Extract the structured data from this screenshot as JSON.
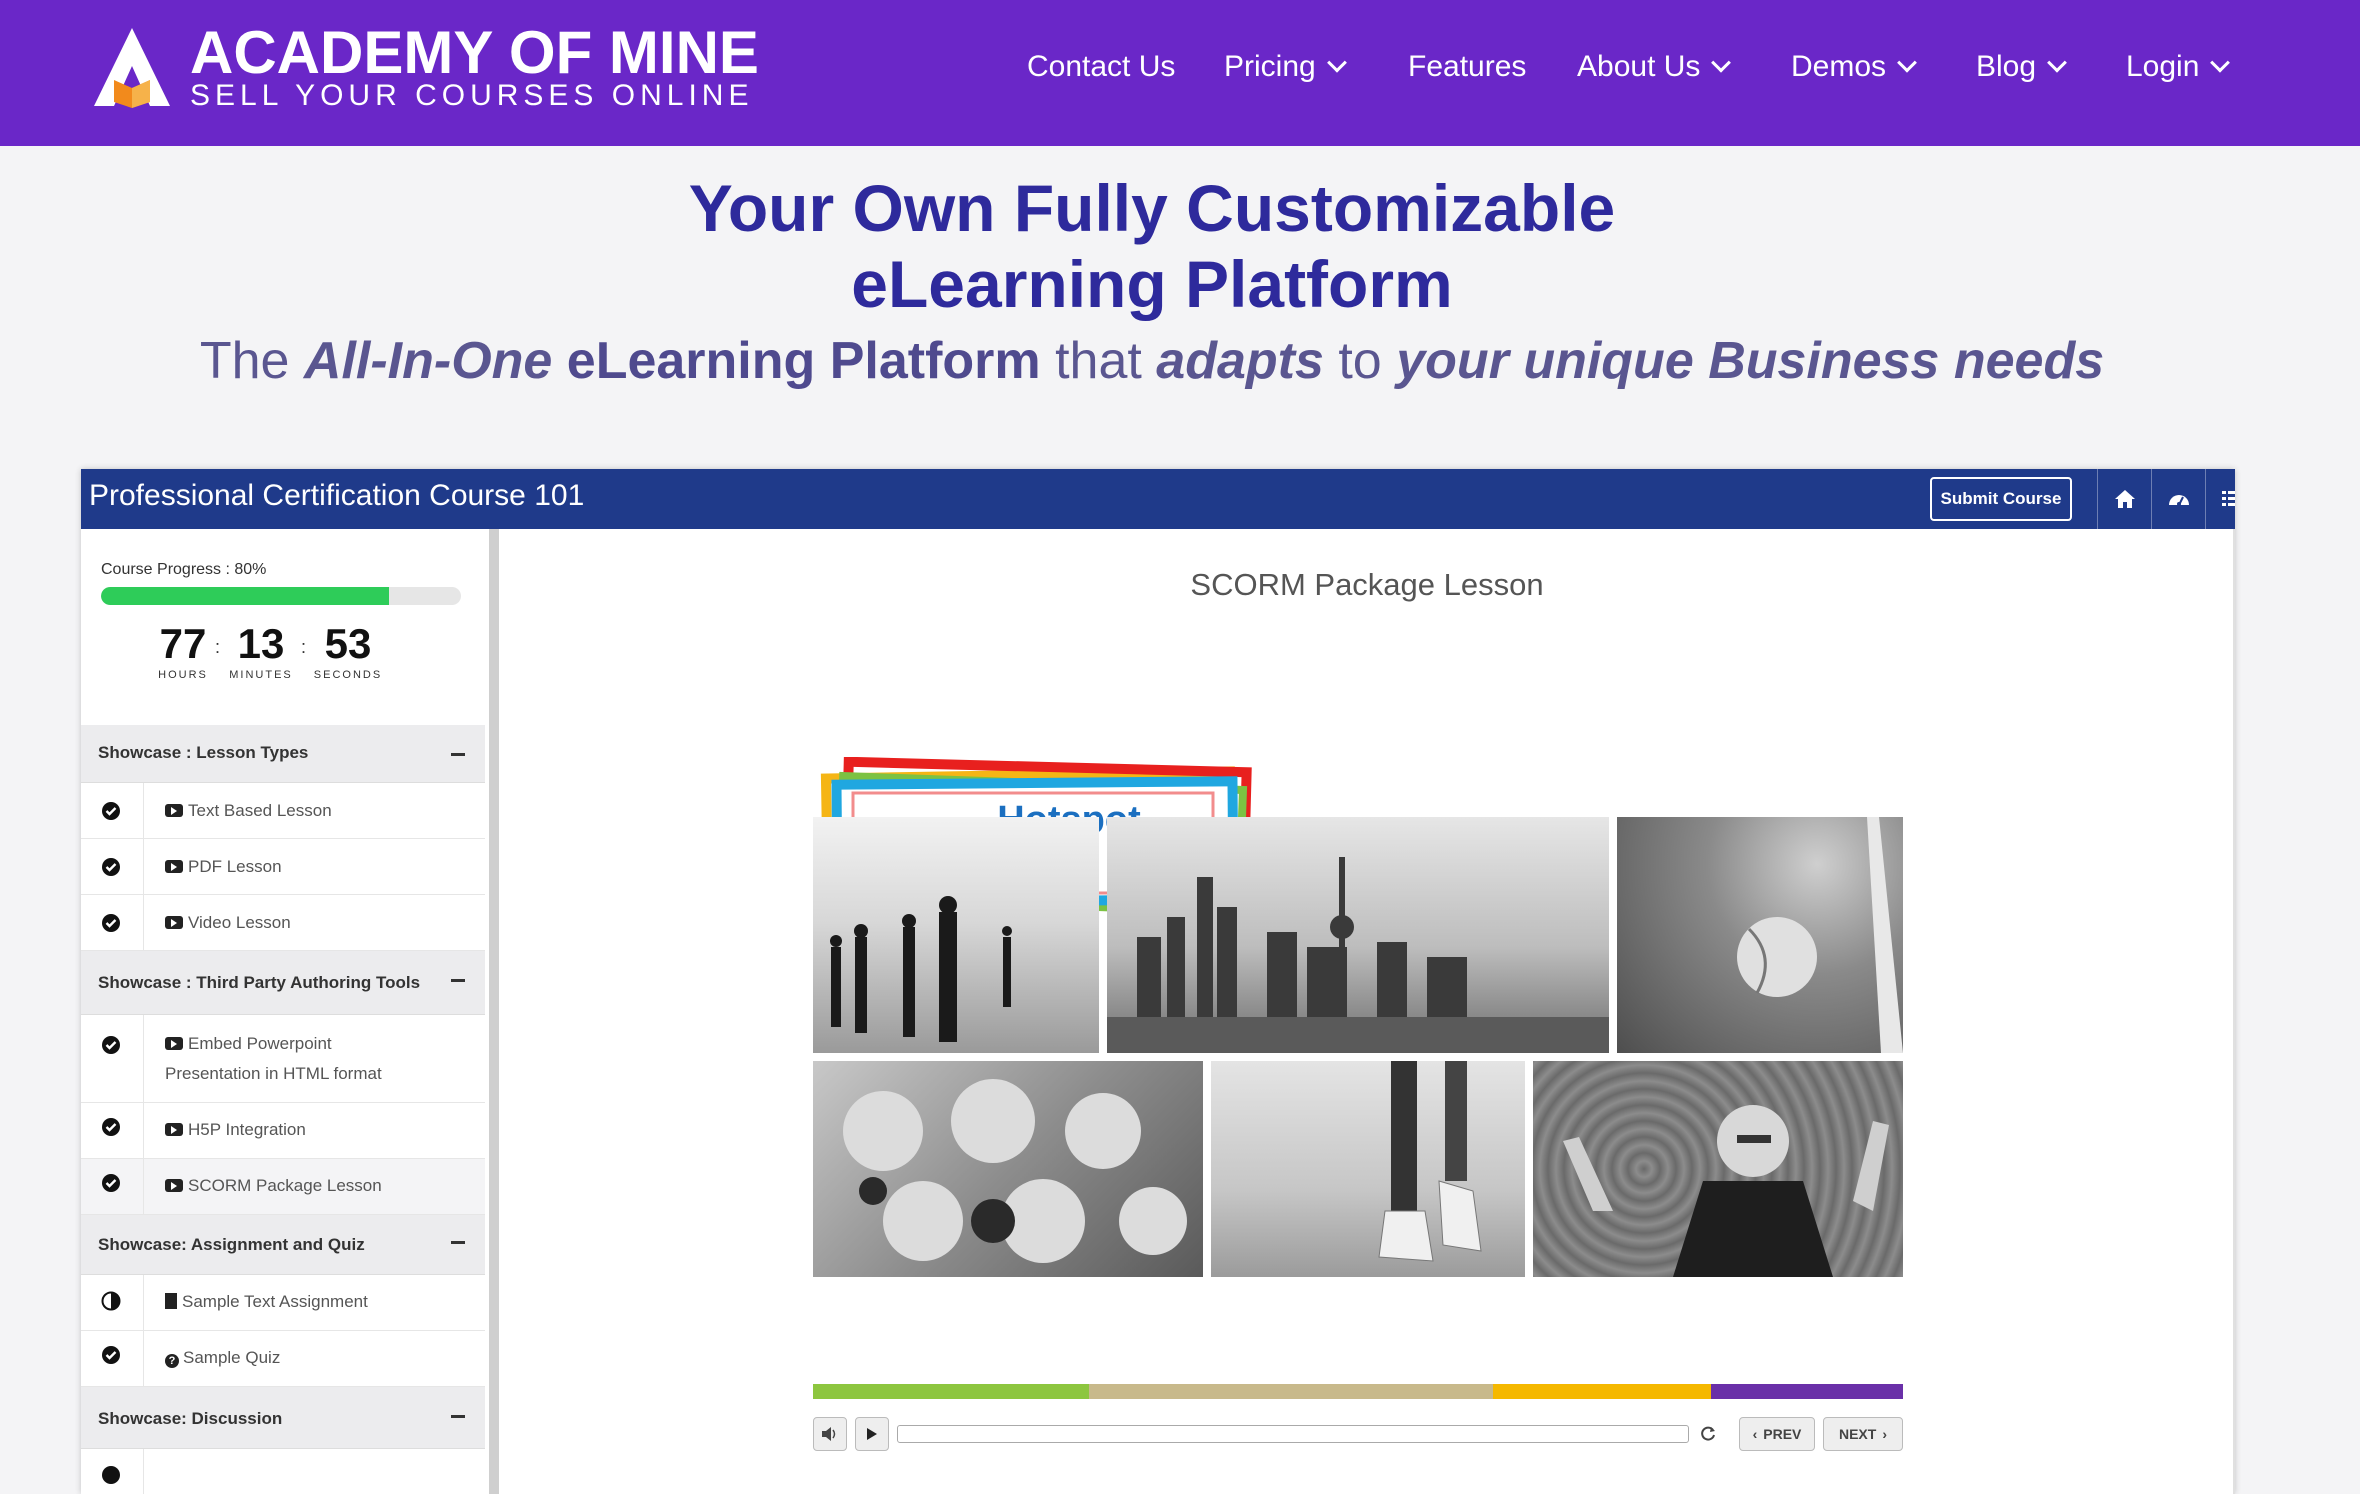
{
  "header": {
    "logo_title": "ACADEMY OF MINE",
    "logo_subtitle": "SELL YOUR COURSES ONLINE",
    "nav": [
      {
        "label": "Contact Us",
        "dropdown": false
      },
      {
        "label": "Pricing",
        "dropdown": true
      },
      {
        "label": "Features",
        "dropdown": false
      },
      {
        "label": "About Us",
        "dropdown": true
      },
      {
        "label": "Demos",
        "dropdown": true
      },
      {
        "label": "Blog",
        "dropdown": true
      },
      {
        "label": "Login",
        "dropdown": true
      }
    ]
  },
  "hero": {
    "title_line1": "Your Own Fully Customizable",
    "title_line2": "eLearning Platform",
    "sub_the": "The",
    "sub_all_in_one": "All-In-One",
    "sub_platform": "eLearning Platform",
    "sub_that": "that",
    "sub_adapts": "adapts",
    "sub_to": "to",
    "sub_needs": "your unique Business needs"
  },
  "course": {
    "title": "Professional Certification Course 101",
    "submit_label": "Submit Course",
    "progress_label": "Course Progress : 80%",
    "progress_fraction": 0.8,
    "timer": {
      "hours": "77",
      "minutes": "13",
      "seconds": "53",
      "hours_label": "HOURS",
      "minutes_label": "MINUTES",
      "seconds_label": "SECONDS"
    },
    "sections": [
      {
        "title": "Showcase : Lesson Types"
      },
      {
        "title": "Showcase : Third Party Authoring Tools"
      },
      {
        "title": "Showcase: Assignment and Quiz"
      },
      {
        "title": "Showcase: Discussion"
      }
    ],
    "lessons": [
      {
        "label": "Text Based Lesson",
        "status": "complete"
      },
      {
        "label": "PDF Lesson",
        "status": "complete"
      },
      {
        "label": "Video Lesson",
        "status": "complete"
      },
      {
        "label": "Embed Powerpoint",
        "label2": "Presentation in HTML format",
        "status": "complete"
      },
      {
        "label": "H5P Integration",
        "status": "complete"
      },
      {
        "label": "SCORM Package Lesson",
        "status": "complete"
      },
      {
        "label": "Sample Text Assignment",
        "status": "partial"
      },
      {
        "label": "Sample Quiz",
        "status": "complete"
      }
    ]
  },
  "content": {
    "lesson_title": "SCORM Package Lesson",
    "hotspot_label": "Hotspot",
    "player": {
      "prev_label": "PREV",
      "next_label": "NEXT"
    }
  },
  "colors": {
    "header_bg": "#6a27c8",
    "hero_title": "#2e2a9c",
    "course_bar": "#1f3a8a",
    "progress": "#2ecc59",
    "hotspot_text": "#1b6fc0"
  }
}
